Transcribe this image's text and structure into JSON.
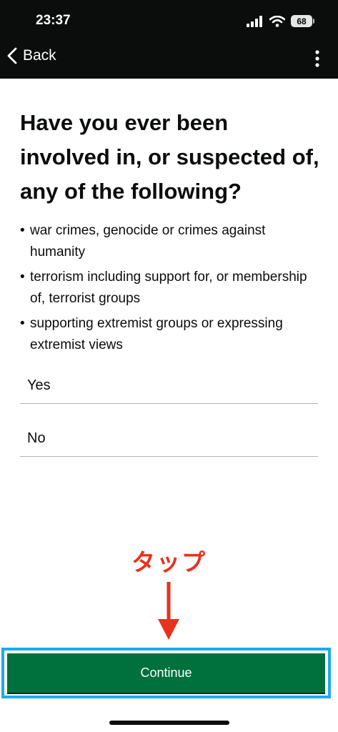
{
  "status_bar": {
    "time": "23:37",
    "battery": "68"
  },
  "nav": {
    "back_label": "Back"
  },
  "question": {
    "title": "Have you ever been involved in, or suspected of, any of the following?"
  },
  "list_items": [
    "war crimes, genocide or crimes against humanity",
    "terrorism including support for, or membership of, terrorist groups",
    "supporting extremist groups or expressing extremist views"
  ],
  "bullet_glyph": "•",
  "options": {
    "yes": "Yes",
    "no": "No"
  },
  "annotation": {
    "text": "タップ",
    "color": "#e8321e"
  },
  "button": {
    "continue_label": "Continue",
    "color": "#00703c"
  },
  "highlight_color": "#1fa9ea"
}
